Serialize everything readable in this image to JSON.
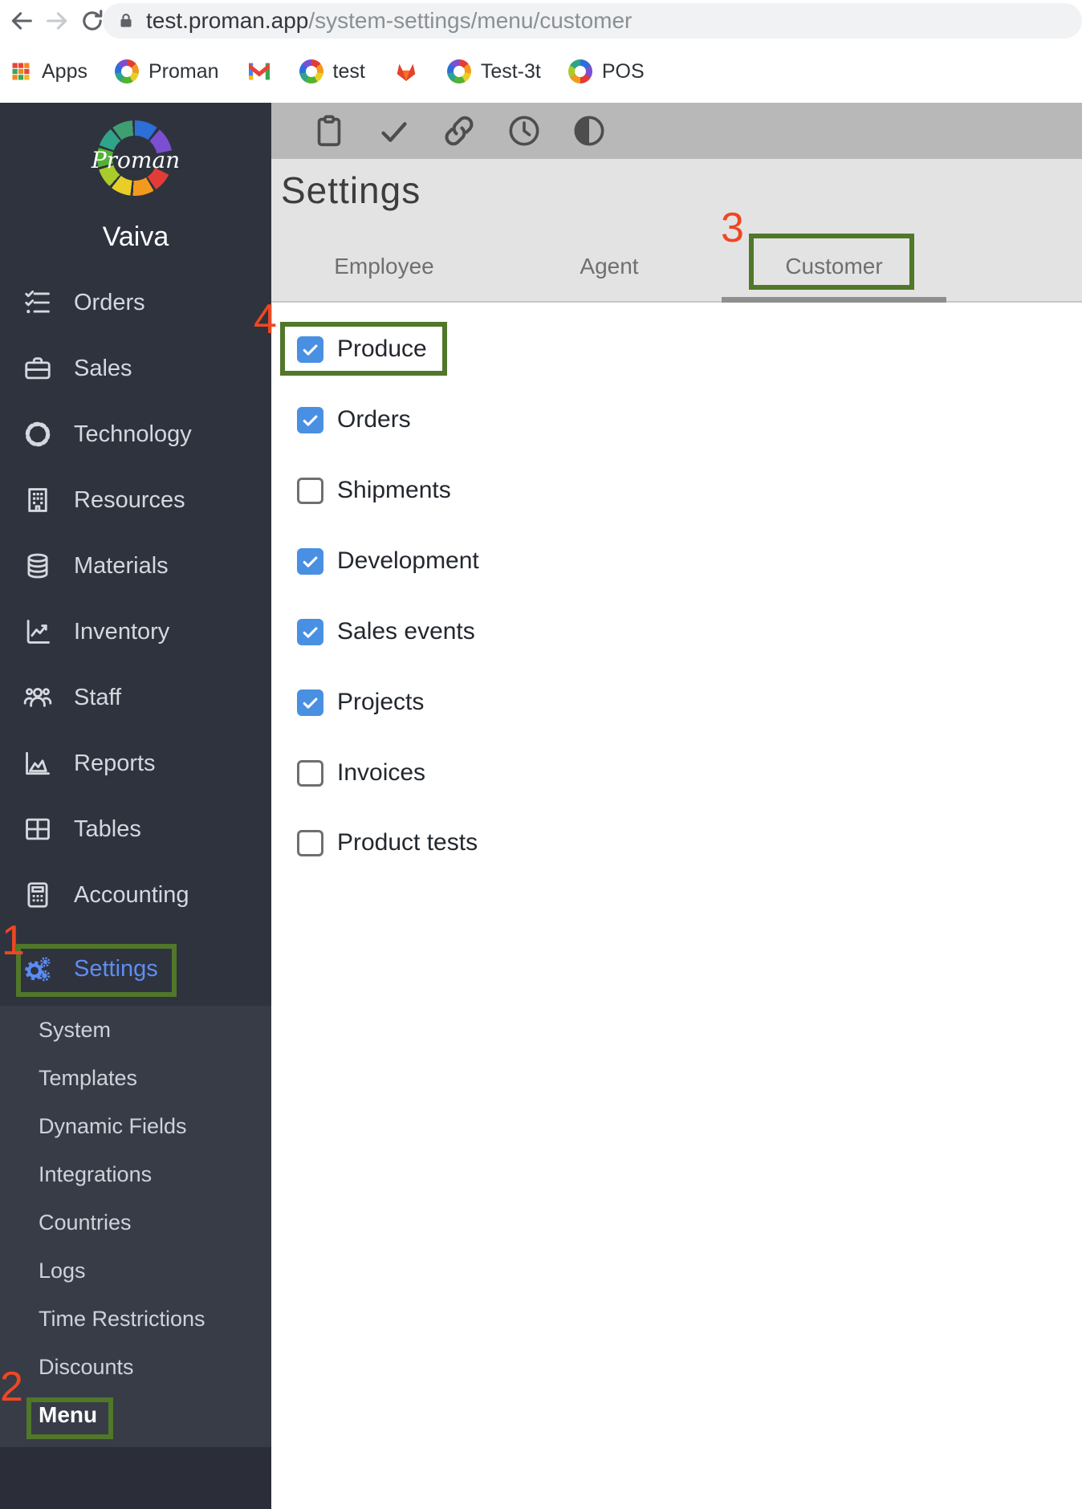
{
  "browser": {
    "url_host": "test.proman.app",
    "url_path": "/system-settings/menu/customer",
    "bookmarks": [
      {
        "label": "Apps",
        "icon": "apps-grid-icon"
      },
      {
        "label": "Proman",
        "icon": "proman-icon"
      },
      {
        "label": "",
        "icon": "gmail-icon"
      },
      {
        "label": "test",
        "icon": "proman-icon"
      },
      {
        "label": "",
        "icon": "gitlab-icon"
      },
      {
        "label": "Test-3t",
        "icon": "proman-icon"
      },
      {
        "label": "POS",
        "icon": "prochef-icon"
      }
    ]
  },
  "sidebar": {
    "brand": "Proman",
    "user": "Vaiva",
    "items": [
      {
        "label": "Orders",
        "icon": "orders-checklist-icon",
        "active": false
      },
      {
        "label": "Sales",
        "icon": "briefcase-icon",
        "active": false
      },
      {
        "label": "Technology",
        "icon": "badge-gear-icon",
        "active": false
      },
      {
        "label": "Resources",
        "icon": "building-icon",
        "active": false
      },
      {
        "label": "Materials",
        "icon": "database-icon",
        "active": false
      },
      {
        "label": "Inventory",
        "icon": "inventory-chart-icon",
        "active": false
      },
      {
        "label": "Staff",
        "icon": "people-icon",
        "active": false
      },
      {
        "label": "Reports",
        "icon": "report-chart-icon",
        "active": false
      },
      {
        "label": "Tables",
        "icon": "table-grid-icon",
        "active": false
      },
      {
        "label": "Accounting",
        "icon": "calculator-icon",
        "active": false
      },
      {
        "label": "Settings",
        "icon": "gears-icon",
        "active": true
      }
    ],
    "submenu_items": [
      {
        "label": "System",
        "active": false
      },
      {
        "label": "Templates",
        "active": false
      },
      {
        "label": "Dynamic Fields",
        "active": false
      },
      {
        "label": "Integrations",
        "active": false
      },
      {
        "label": "Countries",
        "active": false
      },
      {
        "label": "Logs",
        "active": false
      },
      {
        "label": "Time Restrictions",
        "active": false
      },
      {
        "label": "Discounts",
        "active": false
      },
      {
        "label": "Menu",
        "active": true
      }
    ]
  },
  "main": {
    "title": "Settings",
    "toolbar_icons": [
      "clipboard-icon",
      "check-icon",
      "link-icon",
      "clock-icon",
      "contrast-icon"
    ],
    "tabs": [
      {
        "label": "Employee",
        "active": false
      },
      {
        "label": "Agent",
        "active": false
      },
      {
        "label": "Customer",
        "active": true
      }
    ],
    "checkboxes": [
      {
        "label": "Produce",
        "checked": true
      },
      {
        "label": "Orders",
        "checked": true
      },
      {
        "label": "Shipments",
        "checked": false
      },
      {
        "label": "Development",
        "checked": true
      },
      {
        "label": "Sales events",
        "checked": true
      },
      {
        "label": "Projects",
        "checked": true
      },
      {
        "label": "Invoices",
        "checked": false
      },
      {
        "label": "Product tests",
        "checked": false
      }
    ]
  },
  "annotations": {
    "box_color": "#50772a",
    "number_color": "#ee4723",
    "steps": [
      {
        "n": "1",
        "target": "settings-nav-item"
      },
      {
        "n": "2",
        "target": "menu-submenu-item"
      },
      {
        "n": "3",
        "target": "customer-tab"
      },
      {
        "n": "4",
        "target": "produce-checkbox"
      }
    ]
  },
  "colors": {
    "sidebar_bg": "#2f333e",
    "submenu_bg": "#383c47",
    "active_blue": "#5e8df3",
    "checkbox_blue": "#4a90e2",
    "toolbar_bg": "#b8b8b8",
    "header_bg": "#e3e3e3"
  }
}
